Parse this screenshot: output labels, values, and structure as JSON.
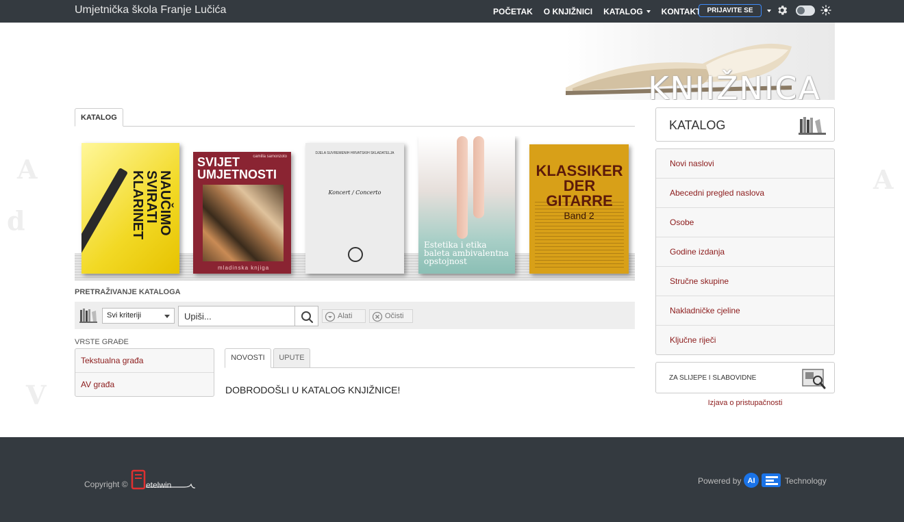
{
  "header": {
    "site_title": "Umjetnička škola Franje Lučića",
    "nav": [
      {
        "label": "POČETAK"
      },
      {
        "label": "O KNJIŽNICI"
      },
      {
        "label": "KATALOG",
        "dropdown": true
      },
      {
        "label": "KONTAKT"
      }
    ],
    "login_label": "PRIJAVITE SE"
  },
  "banner": {
    "text": "KNJIŽNICA"
  },
  "main_tab": {
    "label": "KATALOG"
  },
  "carousel": {
    "books": [
      {
        "title": "NAUČIMO SVIRATI KLARINET"
      },
      {
        "title": "SVIJET UMJETNOSTI",
        "author": "camilla samonzoto",
        "publisher": "mladinska knjiga"
      },
      {
        "title": "Koncert / Concerto",
        "series": "DJELA SUVREMENIH HRVATSKIH SKLADATELJA"
      },
      {
        "title": "Estetika i etika baleta ambivalentna opstojnost"
      },
      {
        "title": "KLASSIKER DER GITARRE",
        "subtitle": "Band 2"
      }
    ]
  },
  "search": {
    "section_label": "PRETRAŽIVANJE KATALOGA",
    "criteria_selected": "Svi kriteriji",
    "input_placeholder": "Upiši...",
    "tools_label": "Alati",
    "clear_label": "Očisti"
  },
  "material_types": {
    "section_label": "VRSTE GRAĐE",
    "items": [
      {
        "label": "Tekstualna građa"
      },
      {
        "label": "AV građa"
      }
    ]
  },
  "news": {
    "tabs": [
      {
        "label": "NOVOSTI",
        "active": true
      },
      {
        "label": "UPUTE",
        "active": false
      }
    ],
    "welcome_text": "DOBRODOŠLI U KATALOG KNJIŽNICE!"
  },
  "sidebar": {
    "title": "KATALOG",
    "items": [
      {
        "label": "Novi naslovi"
      },
      {
        "label": "Abecedni pregled naslova"
      },
      {
        "label": "Osobe"
      },
      {
        "label": "Godine izdanja"
      },
      {
        "label": "Stručne skupine"
      },
      {
        "label": "Nakladničke cjeline"
      },
      {
        "label": "Ključne riječi"
      }
    ],
    "accessibility_label": "ZA SLIJEPE I SLABOVIDNE",
    "accessibility_statement": "Izjava o pristupačnosti"
  },
  "footer": {
    "copyright": "Copyright ©",
    "metel_logo_text": "etelwin",
    "powered_by": "Powered by",
    "technology": "Technology",
    "ai_badge": "AI"
  },
  "colors": {
    "navbar_bg": "#343a40",
    "link_red": "#8b1a1a",
    "login_border": "#3d8bfd",
    "footer_bg": "#343a40"
  }
}
